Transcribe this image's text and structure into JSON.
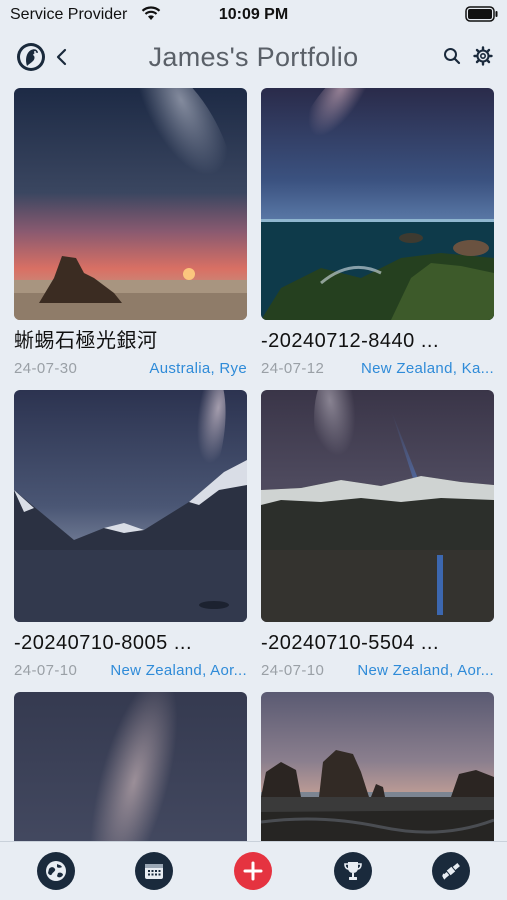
{
  "status": {
    "carrier": "Service Provider",
    "time": "10:09 PM"
  },
  "header": {
    "title": "James's Portfolio"
  },
  "items": [
    {
      "title": "蜥蜴石極光銀河",
      "date": "24-07-30",
      "location": "Australia, Rye"
    },
    {
      "title": "-20240712-8440 ...",
      "date": "24-07-12",
      "location": "New Zealand, Ka..."
    },
    {
      "title": "-20240710-8005 ...",
      "date": "24-07-10",
      "location": "New Zealand, Aor..."
    },
    {
      "title": "-20240710-5504 ...",
      "date": "24-07-10",
      "location": "New Zealand, Aor..."
    },
    {
      "title": "",
      "date": "",
      "location": ""
    },
    {
      "title": "",
      "date": "",
      "location": ""
    }
  ],
  "tabs": [
    "globe-icon",
    "calendar-icon",
    "add-icon",
    "trophy-icon",
    "satellite-icon"
  ],
  "colors": {
    "accent": "#2f8bd8",
    "add_button": "#e53340",
    "tab_icon_bg": "#1a2a3c",
    "background": "#e8edf3"
  }
}
